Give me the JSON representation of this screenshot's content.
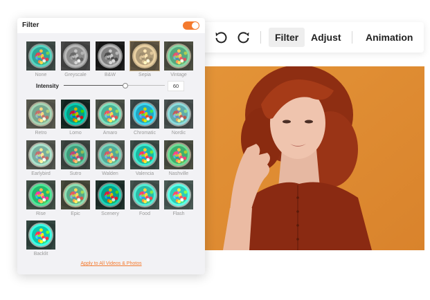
{
  "toolbar": {
    "undo_icon": "undo-icon",
    "redo_icon": "redo-icon",
    "tabs": [
      {
        "label": "Filter",
        "active": true
      },
      {
        "label": "Adjust",
        "active": false
      },
      {
        "label": "Animation",
        "active": false
      }
    ]
  },
  "panel": {
    "title": "Filter",
    "toggle_on": true,
    "accent_color": "#f47a2e",
    "intensity_label": "Intensity",
    "intensity_value": "60",
    "intensity_fraction": 0.6,
    "apply_link": "Apply to All Videos & Photos",
    "selected_filter": "Sepia",
    "filters": [
      "None",
      "Greyscale",
      "B&W",
      "Sepia",
      "Vintage",
      "Retro",
      "Lomo",
      "Amaro",
      "Chromatic",
      "Nordic",
      "Earlybird",
      "Sutro",
      "Walden",
      "Valencia",
      "Nashville",
      "Rise",
      "Epic",
      "Scenery",
      "Food",
      "Flash",
      "Backlit"
    ]
  }
}
